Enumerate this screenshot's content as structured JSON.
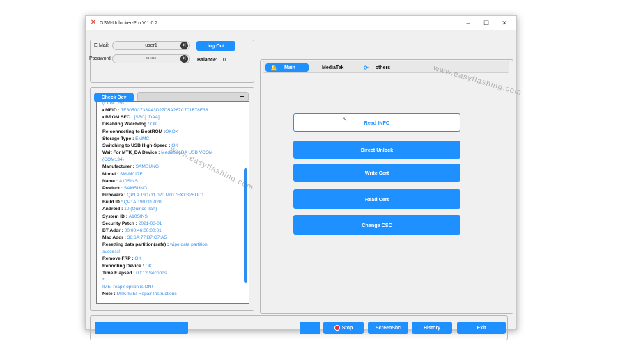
{
  "window": {
    "title": "GSM-Unlocker-Pro V 1.0.2",
    "minimize": "–",
    "maximize": "☐",
    "close": "✕"
  },
  "login": {
    "email_label": "E-Mail:",
    "email_value": "user1",
    "password_label": "Password:",
    "password_value": "••••••",
    "logout_label": "log Out",
    "balance_label": "Balance:",
    "balance_value": "0"
  },
  "device": {
    "check_label": "Check Dev",
    "dropdown_value": ""
  },
  "log": [
    {
      "k": "",
      "v": "(COM129)"
    },
    {
      "k": "• MEID : ",
      "v": "7E6050C733A43D27D5A267C701F78E38"
    },
    {
      "k": "• BROM SEC     : ",
      "v": "[SBC] [DAA]"
    },
    {
      "k": "Disabling Watchdog : ",
      "v": "OK"
    },
    {
      "k": "Re-connecting to BootROM :",
      "v": "OKOK"
    },
    {
      "k": "Storage Type : ",
      "v": "EMMC"
    },
    {
      "k": "Switching to USB High-Speed : ",
      "v": "OK"
    },
    {
      "k": "Wait For MTK_DA Device : ",
      "v": "Mediatek DA USB VCOM"
    },
    {
      "k": "",
      "v": "(COM134)"
    },
    {
      "k": "Manufacturer : ",
      "v": "SAMSUNG"
    },
    {
      "k": "Model : ",
      "v": "SM-M017F"
    },
    {
      "k": "Name : ",
      "v": "A10SINS"
    },
    {
      "k": "Product : ",
      "v": "SAMSUNG"
    },
    {
      "k": "Firmware : ",
      "v": "QP1A.190711.020.M017FXXS2BUC1"
    },
    {
      "k": "Build ID : ",
      "v": "QP1A.190711.020"
    },
    {
      "k": "Android : ",
      "v": "10 (Quince Tart)"
    },
    {
      "k": "System ID : ",
      "v": "A10SINS"
    },
    {
      "k": "Security Patch : ",
      "v": "2021-03-01"
    },
    {
      "k": "BT Addr : ",
      "v": "00:00:46:00:00:01"
    },
    {
      "k": "Mac Addr : ",
      "v": "38:6A:77:B7:C7:A5"
    },
    {
      "k": " Resetting data partition(safe)  : ",
      "v": "wipe data partition"
    },
    {
      "k": "",
      "v": "success!"
    },
    {
      "k": "Remove FRP : ",
      "v": "OK"
    },
    {
      "k": "Rebooting Device : ",
      "v": "OK"
    },
    {
      "k": "Time Elapsed : ",
      "v": "00:12 Seconds"
    },
    {
      "k": "",
      "v": "*"
    },
    {
      "k": "",
      "v": "IMEI reapir option is ON!"
    },
    {
      "k": "Note : ",
      "v": "MTK IMEI Repair Instructions"
    }
  ],
  "tabs": [
    {
      "label": "Main",
      "icon": "bell-icon"
    },
    {
      "label": "MediaTek",
      "icon": ""
    },
    {
      "label": "others",
      "icon": "refresh-icon"
    }
  ],
  "actions": {
    "read_info": "Read INFO",
    "direct_unlock": "Direct Unlock",
    "write_cert": "Write Cert",
    "read_cert": "Read Cert",
    "change_csc": "Change CSC"
  },
  "bottom": {
    "stop": "Stop",
    "screenshot": "ScreenShc",
    "history": "History",
    "exit": "Exit"
  },
  "watermark": "www.easyflashing.com",
  "colors": {
    "accent": "#1e90ff",
    "log_value": "#3a90e8",
    "stop": "#e53030"
  }
}
